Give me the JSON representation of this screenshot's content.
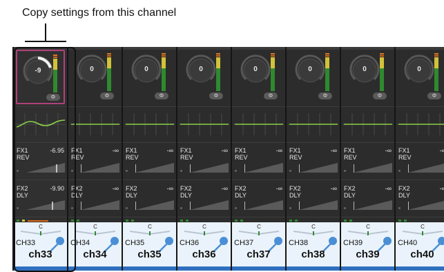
{
  "callout": {
    "text": "Copy settings from this channel"
  },
  "icons": {
    "pan": "pan-indicator",
    "mic": "microphone-icon",
    "phase": "phase-icon"
  },
  "colors": {
    "highlight_border": "#b0417a",
    "meter_green": "#2f8a2f",
    "meter_yellow": "#d2c23a",
    "eq_curve": "#8bd24a",
    "channel_blue": "#2f6fbf"
  },
  "channels": [
    {
      "num": "CH33",
      "name": "ch33",
      "gain": "-9",
      "phase": "Φ",
      "fx1_label": "FX1",
      "fx1_type": "REV",
      "fx1_value": "-6.95",
      "fx2_label": "FX2",
      "fx2_type": "DLY",
      "fx2_value": "-9.90",
      "pan": "C",
      "highlight": true
    },
    {
      "num": "CH34",
      "name": "ch34",
      "gain": "0",
      "phase": "Φ",
      "fx1_label": "FX1",
      "fx1_type": "REV",
      "fx1_value": "-∞",
      "fx2_label": "FX2",
      "fx2_type": "DLY",
      "fx2_value": "-∞",
      "pan": "C"
    },
    {
      "num": "CH35",
      "name": "ch35",
      "gain": "0",
      "phase": "Φ",
      "fx1_label": "FX1",
      "fx1_type": "REV",
      "fx1_value": "-∞",
      "fx2_label": "FX2",
      "fx2_type": "DLY",
      "fx2_value": "-∞",
      "pan": "C"
    },
    {
      "num": "CH36",
      "name": "ch36",
      "gain": "0",
      "phase": "Φ",
      "fx1_label": "FX1",
      "fx1_type": "REV",
      "fx1_value": "-∞",
      "fx2_label": "FX2",
      "fx2_type": "DLY",
      "fx2_value": "-∞",
      "pan": "C"
    },
    {
      "num": "CH37",
      "name": "ch37",
      "gain": "0",
      "phase": "Φ",
      "fx1_label": "FX1",
      "fx1_type": "REV",
      "fx1_value": "-∞",
      "fx2_label": "FX2",
      "fx2_type": "DLY",
      "fx2_value": "-∞",
      "pan": "C"
    },
    {
      "num": "CH38",
      "name": "ch38",
      "gain": "0",
      "phase": "Φ",
      "fx1_label": "FX1",
      "fx1_type": "REV",
      "fx1_value": "-∞",
      "fx2_label": "FX2",
      "fx2_type": "DLY",
      "fx2_value": "-∞",
      "pan": "C"
    },
    {
      "num": "CH39",
      "name": "ch39",
      "gain": "0",
      "phase": "Φ",
      "fx1_label": "FX1",
      "fx1_type": "REV",
      "fx1_value": "-∞",
      "fx2_label": "FX2",
      "fx2_type": "DLY",
      "fx2_value": "-∞",
      "pan": "C"
    },
    {
      "num": "CH40",
      "name": "ch40",
      "gain": "0",
      "phase": "Φ",
      "fx1_label": "FX1",
      "fx1_type": "REV",
      "fx1_value": "-∞",
      "fx2_label": "FX2",
      "fx2_type": "DLY",
      "fx2_value": "-∞",
      "pan": "C"
    }
  ]
}
